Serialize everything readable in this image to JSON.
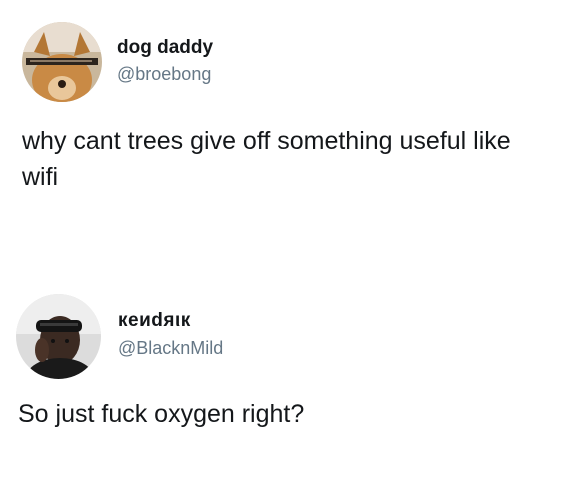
{
  "tweets": [
    {
      "display_name": "dog daddy",
      "handle": "@broebong",
      "text": "why cant trees give off something useful like wifi",
      "avatar_icon": "dog-photo-avatar"
    },
    {
      "display_name": "кеиdяιк",
      "handle": "@BlacknMild",
      "text": "So just fuck oxygen right?",
      "avatar_icon": "person-photo-avatar"
    }
  ]
}
